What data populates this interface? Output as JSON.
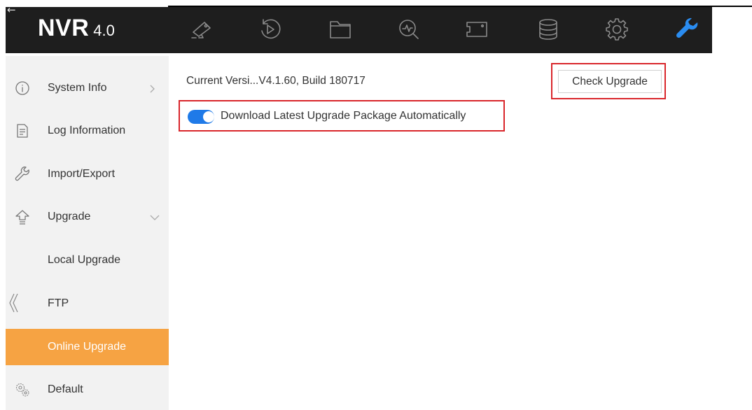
{
  "topbar": {
    "brand_main": "NVR",
    "brand_version": "4.0",
    "back_icon": "arrow-left-icon",
    "nav_icons": [
      "camera-icon",
      "playback-icon",
      "folder-icon",
      "search-icon",
      "frame-icon",
      "storage-icon",
      "gear-icon",
      "wrench-icon"
    ],
    "active_icon": "wrench-icon",
    "background": "#1e1e1e",
    "active_color": "#2a8cf0"
  },
  "sidebar": {
    "background": "#f2f2f2",
    "active_color": "#f6a343",
    "items": [
      {
        "label": "System Info",
        "icon": "info-icon",
        "indicator": "chevron-right-icon"
      },
      {
        "label": "Log Information",
        "icon": "document-icon"
      },
      {
        "label": "Import/Export",
        "icon": "wrench-icon"
      },
      {
        "label": "Upgrade",
        "icon": "upgrade-icon",
        "indicator": "chevron-down-icon"
      },
      {
        "label": "Local Upgrade"
      },
      {
        "label": "FTP"
      },
      {
        "label": "Online Upgrade",
        "active": true
      },
      {
        "label": "Default",
        "icon": "gears-icon"
      }
    ],
    "collapse_icon": "double-chevron-left-icon"
  },
  "main": {
    "version_text": "Current Versi...V4.1.60, Build 180717",
    "check_upgrade_label": "Check Upgrade",
    "auto_download_label": "Download Latest Upgrade Package Automatically",
    "auto_download_enabled": true,
    "toggle_color": "#1f7ae8",
    "highlight_color": "#d9262b"
  }
}
